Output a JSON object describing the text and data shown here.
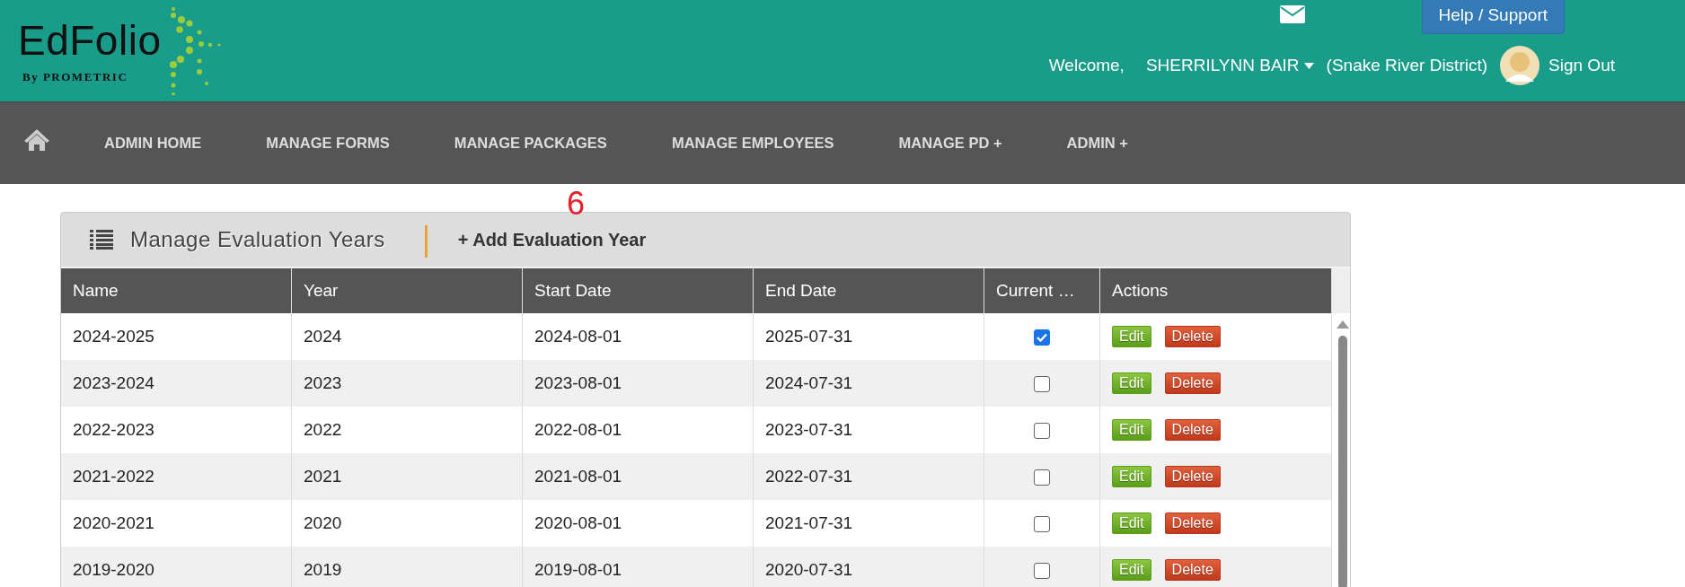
{
  "header": {
    "logo": {
      "name": "EdFolio",
      "byline": "By PROMETRIC"
    },
    "help_button": "Help / Support",
    "welcome": "Welcome,",
    "user": "SHERRILYNN BAIR",
    "district": "(Snake River District)",
    "sign_out": "Sign Out"
  },
  "nav": {
    "items": [
      "ADMIN HOME",
      "MANAGE FORMS",
      "MANAGE PACKAGES",
      "MANAGE EMPLOYEES",
      "MANAGE PD +",
      "ADMIN +"
    ]
  },
  "annotation": "6",
  "panel": {
    "title": "Manage Evaluation Years",
    "add_link": "+ Add Evaluation Year"
  },
  "table": {
    "columns": [
      "Name",
      "Year",
      "Start Date",
      "End Date",
      "Current …",
      "Actions"
    ],
    "rows": [
      {
        "name": "2024-2025",
        "year": "2024",
        "start": "2024-08-01",
        "end": "2025-07-31",
        "current": true,
        "edit": "Edit",
        "delete": "Delete"
      },
      {
        "name": "2023-2024",
        "year": "2023",
        "start": "2023-08-01",
        "end": "2024-07-31",
        "current": false,
        "edit": "Edit",
        "delete": "Delete"
      },
      {
        "name": "2022-2023",
        "year": "2022",
        "start": "2022-08-01",
        "end": "2023-07-31",
        "current": false,
        "edit": "Edit",
        "delete": "Delete"
      },
      {
        "name": "2021-2022",
        "year": "2021",
        "start": "2021-08-01",
        "end": "2022-07-31",
        "current": false,
        "edit": "Edit",
        "delete": "Delete"
      },
      {
        "name": "2020-2021",
        "year": "2020",
        "start": "2020-08-01",
        "end": "2021-07-31",
        "current": false,
        "edit": "Edit",
        "delete": "Delete"
      },
      {
        "name": "2019-2020",
        "year": "2019",
        "start": "2019-08-01",
        "end": "2020-07-31",
        "current": false,
        "edit": "Edit",
        "delete": "Delete"
      }
    ]
  }
}
